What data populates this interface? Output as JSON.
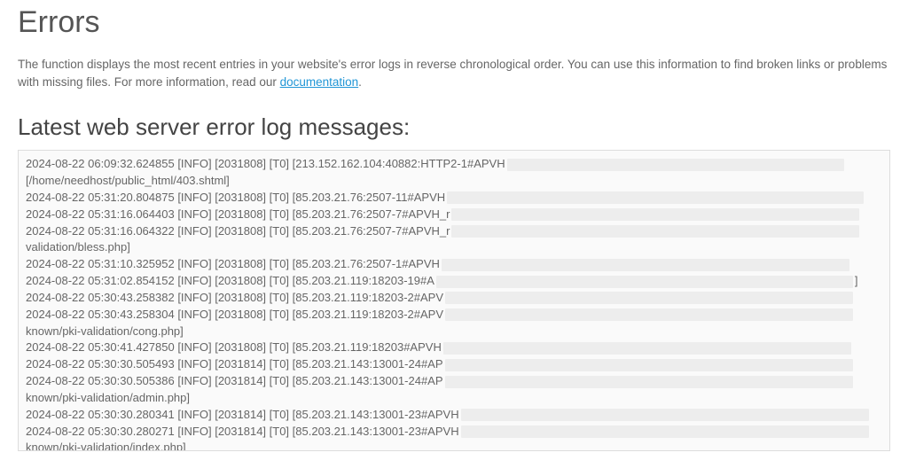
{
  "header": {
    "title": "Errors"
  },
  "intro": {
    "text_before": "The function displays the most recent entries in your website's error logs in reverse chronological order. You can use this information to find broken links or problems with missing files. For more information, read our ",
    "link_text": "documentation",
    "text_after": "."
  },
  "section": {
    "title": "Latest web server error log messages:"
  },
  "log": {
    "lines": [
      {
        "prefix": "2024-08-22 06:09:32.624855 [INFO] [2031808] [T0] [213.152.162.104:40882:HTTP2-1#APVH",
        "redact": "med",
        "cont": "[/home/needhost/public_html/403.shtml]"
      },
      {
        "prefix": "2024-08-22 05:31:20.804875 [INFO] [2031808] [T0] [85.203.21.76:2507-11#APVH",
        "redact": "full"
      },
      {
        "prefix": "2024-08-22 05:31:16.064403 [INFO] [2031808] [T0] [85.203.21.76:2507-7#APVH_r",
        "redact": "long"
      },
      {
        "prefix": "2024-08-22 05:31:16.064322 [INFO] [2031808] [T0] [85.203.21.76:2507-7#APVH_r",
        "redact": "long",
        "cont": "validation/bless.php]"
      },
      {
        "prefix": "2024-08-22 05:31:10.325952 [INFO] [2031808] [T0] [85.203.21.76:2507-1#APVH",
        "redact": "long"
      },
      {
        "prefix": "2024-08-22 05:31:02.854152 [INFO] [2031808] [T0] [85.203.21.119:18203-19#A",
        "redact": "full",
        "trailing": "]"
      },
      {
        "prefix": "2024-08-22 05:30:43.258382 [INFO] [2031808] [T0] [85.203.21.119:18203-2#APV",
        "redact": "long"
      },
      {
        "prefix": "2024-08-22 05:30:43.258304 [INFO] [2031808] [T0] [85.203.21.119:18203-2#APV",
        "redact": "long",
        "cont": "known/pki-validation/cong.php]"
      },
      {
        "prefix": "2024-08-22 05:30:41.427850 [INFO] [2031808] [T0] [85.203.21.119:18203#APVH",
        "redact": "long"
      },
      {
        "prefix": "2024-08-22 05:30:30.505493 [INFO] [2031814] [T0] [85.203.21.143:13001-24#AP",
        "redact": "long"
      },
      {
        "prefix": "2024-08-22 05:30:30.505386 [INFO] [2031814] [T0] [85.203.21.143:13001-24#AP",
        "redact": "long",
        "cont": "known/pki-validation/admin.php]"
      },
      {
        "prefix": "2024-08-22 05:30:30.280341 [INFO] [2031814] [T0] [85.203.21.143:13001-23#APVH",
        "redact": "long"
      },
      {
        "prefix": "2024-08-22 05:30:30.280271 [INFO] [2031814] [T0] [85.203.21.143:13001-23#APVH",
        "redact": "long",
        "cont": "known/pki-validation/index.php]"
      }
    ]
  }
}
